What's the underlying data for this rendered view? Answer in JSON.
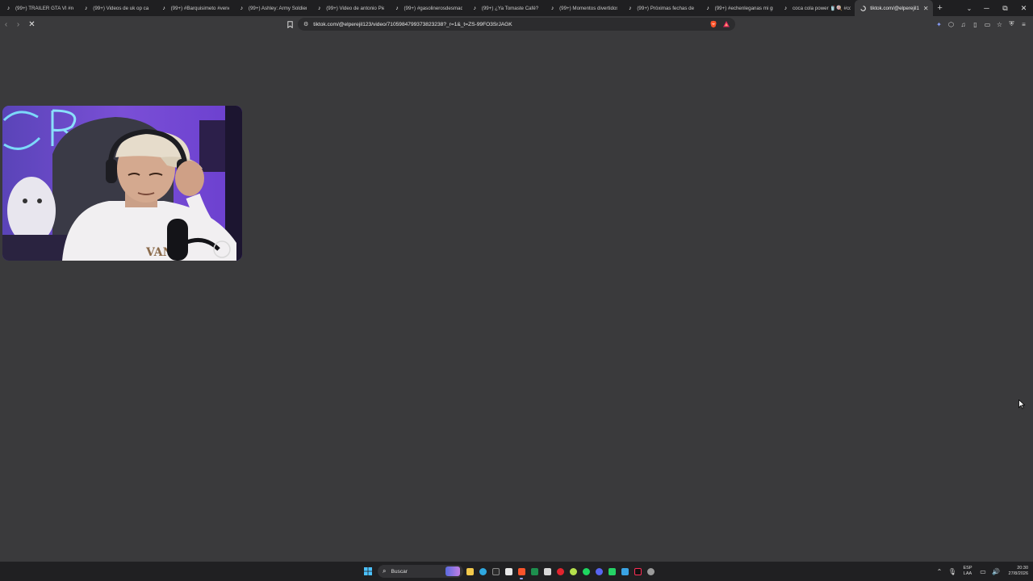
{
  "browser": {
    "tabs": [
      {
        "title": "(99+) TRÁILER GTA VI #reel",
        "icon": "tiktok-icon"
      },
      {
        "title": "(99+) Videos de uk op ca",
        "icon": "tiktok-icon"
      },
      {
        "title": "(99+) #Barquisimeto #vene",
        "icon": "tiktok-icon"
      },
      {
        "title": "(99+) Ashley: Army Soldier",
        "icon": "tiktok-icon"
      },
      {
        "title": "(99+) Video de antonio Pie",
        "icon": "tiktok-icon"
      },
      {
        "title": "(99+) #gasolinerosdesmad",
        "icon": "tiktok-icon"
      },
      {
        "title": "(99+) ¿Ya Tomaste Café? Es",
        "icon": "tiktok-icon"
      },
      {
        "title": "(99+) Momentos divertidos",
        "icon": "tiktok-icon"
      },
      {
        "title": "(99+) Próximas fechas de G",
        "icon": "tiktok-icon"
      },
      {
        "title": "(99+) #echenleganas mi gr",
        "icon": "tiktok-icon"
      },
      {
        "title": "coca cola power 🥤🍭 #cc",
        "icon": "tiktok-icon"
      },
      {
        "title": "tiktok.com/@elperejil1",
        "icon": "loading-icon",
        "active": true
      }
    ],
    "new_tab_label": "+",
    "url": "tiktok.com/@elperejil123/video/7105984799373823238?_r=1&_t=ZS-99FO3SrJAGK",
    "window_controls": {
      "minimize": "─",
      "maximize": "⧉",
      "close": "✕",
      "tabs_menu": "⌄"
    }
  },
  "taskbar": {
    "search_placeholder": "Buscar",
    "language": {
      "line1": "ESP",
      "line2": "LAA"
    },
    "clock": {
      "time": "20:30",
      "date": "27/8/2026"
    }
  },
  "colors": {
    "page_bg": "#3a3a3c",
    "tab_strip_bg": "#1f1f21",
    "taskbar_bg": "#202022",
    "brave_orange": "#fb542b"
  }
}
